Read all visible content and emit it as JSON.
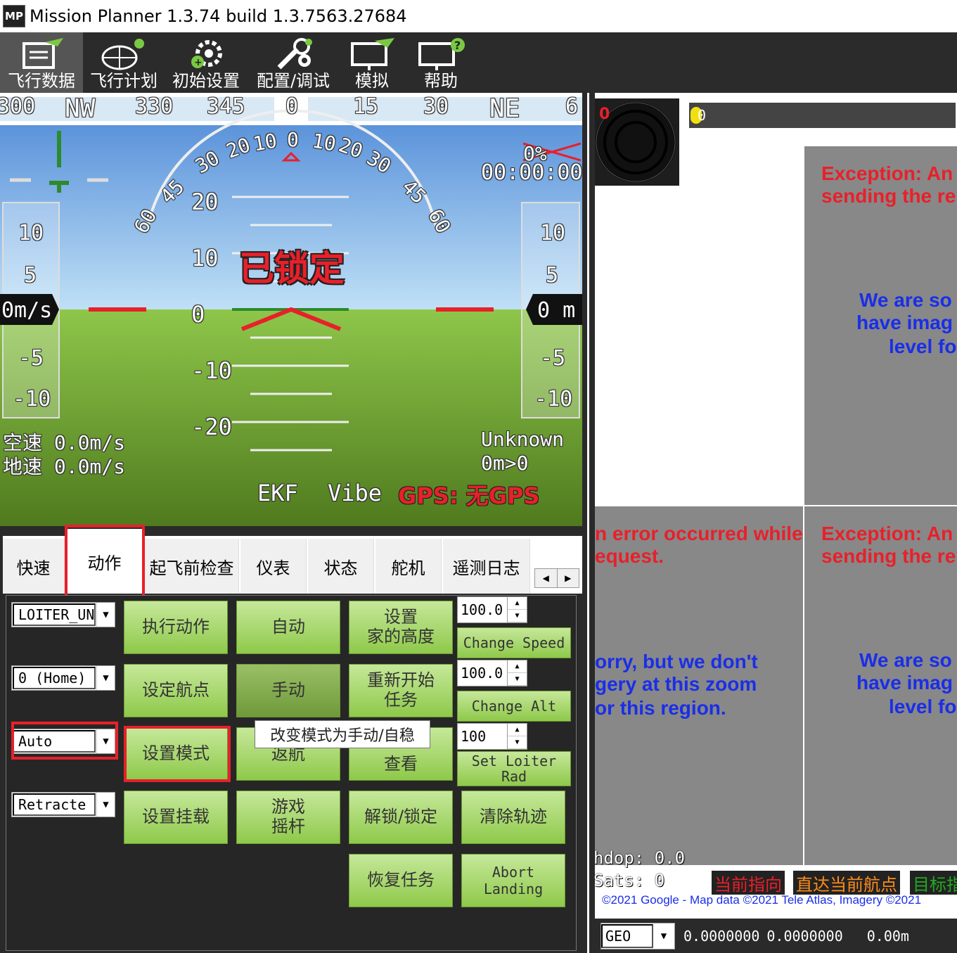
{
  "window": {
    "title": "Mission Planner 1.3.74 build 1.3.7563.27684",
    "icon_label": "MP"
  },
  "toolbar": {
    "items": [
      {
        "label": "飞行数据",
        "icon": "flight-data-icon"
      },
      {
        "label": "飞行计划",
        "icon": "flight-plan-icon"
      },
      {
        "label": "初始设置",
        "icon": "initial-setup-icon"
      },
      {
        "label": "配置/调试",
        "icon": "config-tuning-icon"
      },
      {
        "label": "模拟",
        "icon": "simulation-icon"
      },
      {
        "label": "帮助",
        "icon": "help-icon"
      }
    ]
  },
  "hud": {
    "compass": [
      "300",
      "NW",
      "330",
      "345",
      "0",
      "15",
      "30",
      "NE",
      "6"
    ],
    "roll_labels": [
      "60",
      "45",
      "30",
      "20",
      "10",
      "0",
      "10",
      "20",
      "30",
      "45",
      "60"
    ],
    "pitch_labels": [
      "20",
      "10",
      "0",
      "-10",
      "-20"
    ],
    "armed_status": "已锁定",
    "battery_percent": "0%",
    "timer": "00:00:00",
    "speed_scale": [
      "10",
      "5",
      "-5",
      "-10"
    ],
    "alt_scale": [
      "10",
      "5",
      "-5",
      "-10"
    ],
    "speed_readout": "0m/s",
    "alt_readout": "0 m",
    "airspeed": "空速 0.0m/s",
    "groundspeed": "地速 0.0m/s",
    "mode": "Unknown",
    "wp_dist": "0m>0",
    "ekf": "EKF",
    "vibe": "Vibe",
    "gps": "GPS: 无GPS"
  },
  "tabs": [
    "快速",
    "动作",
    "起飞前检查",
    "仪表",
    "状态",
    "舵机",
    "遥测日志"
  ],
  "actions": {
    "combos": [
      "LOITER_UN",
      "0 (Home)",
      "Auto",
      "Retracte"
    ],
    "buttons": {
      "do_action": "执行动作",
      "auto": "自动",
      "set_home_alt_1": "设置",
      "set_home_alt_2": "家的高度",
      "set_wp": "设定航点",
      "manual": "手动",
      "restart_mission_1": "重新开始",
      "restart_mission_2": "任务",
      "set_mode": "设置模式",
      "rtl": "返航",
      "view_1": "查看",
      "set_mount": "设置挂载",
      "joystick_1": "游戏",
      "joystick_2": "摇杆",
      "arm_disarm": "解锁/锁定",
      "clear_track": "清除轨迹",
      "resume_mission": "恢复任务",
      "abort_landing_1": "Abort",
      "abort_landing_2": "Landing",
      "change_speed": "Change Speed",
      "change_alt": "Change Alt",
      "set_loiter_rad_1": "Set Loiter",
      "set_loiter_rad_2": "Rad"
    },
    "numbers": [
      "100.0",
      "100.0",
      "100"
    ],
    "tooltip": "改变模式为手动/自稳"
  },
  "map": {
    "heading_red": "0",
    "slider_value": "0",
    "tiles": {
      "err_right_top_1": "Exception: An",
      "err_right_top_2": "sending the re",
      "blue_right_top_1": "We are so",
      "blue_right_top_2": "have imag",
      "blue_right_top_3": "level fo",
      "err_left_bottom_1": "n error occurred while",
      "err_left_bottom_2": "equest.",
      "blue_left_bottom_1": "orry, but we don't",
      "blue_left_bottom_2": "gery at this zoom",
      "blue_left_bottom_3": "or this region.",
      "err_right_bottom_1": "Exception: An",
      "err_right_bottom_2": "sending the re",
      "blue_right_bottom_1": "We are so",
      "blue_right_bottom_2": "have imag",
      "blue_right_bottom_3": "level fo"
    },
    "hdop": "hdop: 0.0",
    "sats": "Sats: 0",
    "copyright": "©2021 Google - Map data ©2021 Tele Atlas, Imagery ©2021",
    "legend": [
      "当前指向",
      "直达当前航点",
      "目标指"
    ],
    "legend_colors": [
      "#e8202a",
      "#ff8c1a",
      "#22aa22"
    ]
  },
  "statusbar": {
    "coord_type": "GEO",
    "lat": "0.0000000",
    "lng": "0.0000000",
    "alt": "0.00m"
  }
}
